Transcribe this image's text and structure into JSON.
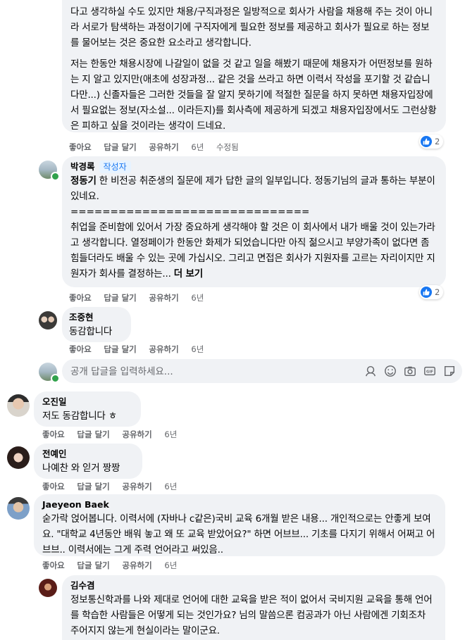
{
  "comment1": {
    "paragraph1": "다고 생각하실 수도 있지만 채용/구직과정은 일방적으로 회사가 사람을 채용해 주는 것이 아니라 서로가 탐색하는 과정이기에 구직자에게 필요한 정보를 제공하고 회사가 필요로 하는 정보를 물어보는 것은 중요한 요소라고 생각합니다.",
    "paragraph2": "저는 한동안 채용시장에 나갈일이 없을 것 같고 일을 해봤기 때문에 채용자가 어떤정보를 원하는 지 알고 있지만(애초에 성장과정... 같은 것을 쓰라고 하면 이력서 작성을 포기할 것 같습니다만...) 신졸자들은 그러한 것들을 잘 알지 못하기에 적절한 질문을 하지 못하면 채용자입장에서 필요없는 정보(자소설... 이라든지)를 회사측에 제공하게 되겠고 채용자입장에서도 그런상황은 피하고 싶을 것이라는 생각이 드네요.",
    "actions": {
      "like": "좋아요",
      "reply": "답글 달기",
      "share": "공유하기",
      "time": "6년",
      "edited": "수정됨"
    },
    "reactions": "2"
  },
  "reply1": {
    "author": "박경록",
    "badge": "작성자",
    "mention": "정동기",
    "line1": " 한 비전공 취준생의 질문에 제가 답한 글의 일부입니다. 정동기님의 글과 통하는 부분이 있네요.",
    "divider": "==============================",
    "body": "취업을 준비함에 있어서 가장 중요하게 생각해야 할 것은 이 회사에서 내가 배울 것이 있는가라고 생각합니다. 열정페이가 한동안 화제가 되었습니다만 아직 젊으시고 부양가족이 없다면 좀 힘들더라도 배울 수 있는 곳에 가십시오. 그리고 면접은 회사가 지원자를 고르는 자리이지만 지원자가 회사를 결정하는... ",
    "more": "더 보기",
    "actions": {
      "like": "좋아요",
      "reply": "답글 달기",
      "share": "공유하기",
      "time": "6년"
    },
    "reactions": "2"
  },
  "reply2": {
    "author": "조중현",
    "text": "동감합니다",
    "actions": {
      "like": "좋아요",
      "reply": "답글 달기",
      "share": "공유하기",
      "time": "6년"
    }
  },
  "reply_input": {
    "placeholder": "공개 답글을 입력하세요..."
  },
  "comment2": {
    "author": "오진일",
    "text": "저도 동감합니다 ㅎ",
    "actions": {
      "like": "좋아요",
      "reply": "답글 달기",
      "share": "공유하기",
      "time": "6년"
    }
  },
  "comment3": {
    "author": "전예인",
    "text": "나예찬 와 읻거 짱짱",
    "actions": {
      "like": "좋아요",
      "reply": "답글 달기",
      "share": "공유하기",
      "time": "6년"
    }
  },
  "comment4": {
    "author": "Jaeyeon Baek",
    "text": "숟가락 얹어봅니다. 이력서에 (자바나 c같은)국비 교육 6개월 받은 내용... 개인적으로는 안좋게 보여요. \"대학교 4년동안 배워 놓고 왜 또 교육 받았어요?\" 하면 어브브... 기초를 다지기 위해서 어쩌고 어브브.. 이력서에는 그게 주력 언어라고 써있음..",
    "actions": {
      "like": "좋아요",
      "reply": "답글 달기",
      "share": "공유하기",
      "time": "6년"
    }
  },
  "reply3": {
    "author": "김수겸",
    "text": "정보통신학과를 나와 제대로 언어에 대한 교육을 받은 적이 없어서 국비지원 교육을 통해 언어를 학습한 사람들은 어떻게 되는 것인가요? 님의 말씀으론 컴공과가 아닌 사람에겐 기회조차 주어지지 않는게 현실이라는 말이군요."
  },
  "colors": {
    "bubble": "#f0f2f5",
    "link": "#1877f2",
    "meta": "#65676b",
    "online": "#31a24c"
  }
}
